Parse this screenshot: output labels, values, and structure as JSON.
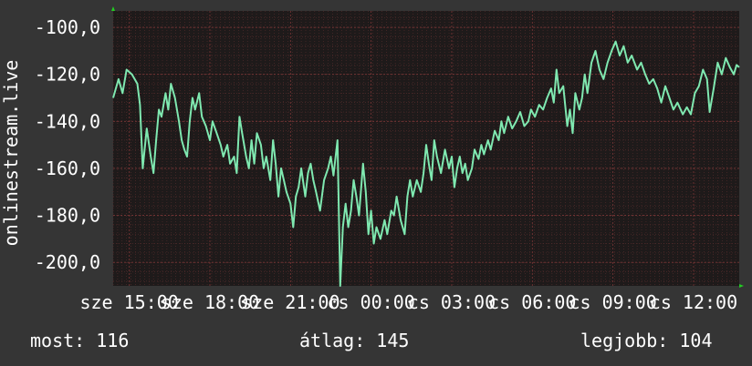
{
  "colors": {
    "background": "#353535",
    "plot_background": "#1e1a1a",
    "grid_minor": "#5a2e2e",
    "grid_major": "#7a3636",
    "line": "#7fe8b0",
    "axis_arrow": "#22cc22",
    "text": "#ffffff"
  },
  "stats": {
    "now_label": "most:",
    "now_value": "116",
    "avg_label": "átlag:",
    "avg_value": "145",
    "best_label": "legjobb:",
    "best_value": "104"
  },
  "chart_data": {
    "type": "line",
    "title": "",
    "ylabel": "onlinestream.live",
    "xlabel": "",
    "y_axis_inverted": true,
    "ylim": [
      -93,
      -210
    ],
    "y_ticks": [
      -100,
      -120,
      -140,
      -160,
      -180,
      -200
    ],
    "y_tick_labels": [
      "-100,0",
      "-120,0",
      "-140,0",
      "-160,0",
      "-180,0",
      "-200,0"
    ],
    "x_range_hours": [
      0,
      23.3
    ],
    "x_ticks": [
      {
        "day": "sze",
        "time": "15:00",
        "t": 0.6
      },
      {
        "day": "sze",
        "time": "18:00",
        "t": 3.6
      },
      {
        "day": "sze",
        "time": "21:00",
        "t": 6.6
      },
      {
        "day": "cs",
        "time": "00:00",
        "t": 9.6
      },
      {
        "day": "cs",
        "time": "03:00",
        "t": 12.6
      },
      {
        "day": "cs",
        "time": "06:00",
        "t": 15.6
      },
      {
        "day": "cs",
        "time": "09:00",
        "t": 18.6
      },
      {
        "day": "cs",
        "time": "12:00",
        "t": 21.6
      }
    ],
    "grid": true,
    "series": [
      {
        "values": [
          [
            0.0,
            -130
          ],
          [
            0.2,
            -122
          ],
          [
            0.35,
            -128
          ],
          [
            0.5,
            -118
          ],
          [
            0.7,
            -120
          ],
          [
            0.9,
            -124
          ],
          [
            1.0,
            -133
          ],
          [
            1.1,
            -160
          ],
          [
            1.25,
            -143
          ],
          [
            1.4,
            -155
          ],
          [
            1.5,
            -162
          ],
          [
            1.6,
            -148
          ],
          [
            1.7,
            -135
          ],
          [
            1.8,
            -138
          ],
          [
            1.95,
            -128
          ],
          [
            2.05,
            -135
          ],
          [
            2.15,
            -124
          ],
          [
            2.3,
            -130
          ],
          [
            2.45,
            -140
          ],
          [
            2.55,
            -148
          ],
          [
            2.65,
            -152
          ],
          [
            2.75,
            -155
          ],
          [
            2.85,
            -140
          ],
          [
            2.95,
            -130
          ],
          [
            3.05,
            -135
          ],
          [
            3.2,
            -128
          ],
          [
            3.3,
            -138
          ],
          [
            3.45,
            -142
          ],
          [
            3.6,
            -148
          ],
          [
            3.7,
            -140
          ],
          [
            3.85,
            -145
          ],
          [
            4.0,
            -150
          ],
          [
            4.1,
            -155
          ],
          [
            4.25,
            -150
          ],
          [
            4.35,
            -158
          ],
          [
            4.5,
            -155
          ],
          [
            4.6,
            -162
          ],
          [
            4.7,
            -138
          ],
          [
            4.8,
            -145
          ],
          [
            4.95,
            -155
          ],
          [
            5.05,
            -160
          ],
          [
            5.15,
            -148
          ],
          [
            5.25,
            -158
          ],
          [
            5.35,
            -145
          ],
          [
            5.5,
            -150
          ],
          [
            5.6,
            -160
          ],
          [
            5.7,
            -155
          ],
          [
            5.85,
            -165
          ],
          [
            5.95,
            -148
          ],
          [
            6.05,
            -158
          ],
          [
            6.15,
            -172
          ],
          [
            6.25,
            -160
          ],
          [
            6.35,
            -165
          ],
          [
            6.45,
            -170
          ],
          [
            6.6,
            -175
          ],
          [
            6.7,
            -185
          ],
          [
            6.8,
            -172
          ],
          [
            6.9,
            -168
          ],
          [
            7.0,
            -160
          ],
          [
            7.15,
            -172
          ],
          [
            7.25,
            -162
          ],
          [
            7.35,
            -158
          ],
          [
            7.45,
            -165
          ],
          [
            7.55,
            -170
          ],
          [
            7.7,
            -178
          ],
          [
            7.85,
            -165
          ],
          [
            8.0,
            -160
          ],
          [
            8.1,
            -155
          ],
          [
            8.2,
            -163
          ],
          [
            8.35,
            -148
          ],
          [
            8.45,
            -210
          ],
          [
            8.55,
            -185
          ],
          [
            8.65,
            -175
          ],
          [
            8.75,
            -185
          ],
          [
            8.85,
            -178
          ],
          [
            8.95,
            -165
          ],
          [
            9.05,
            -172
          ],
          [
            9.15,
            -180
          ],
          [
            9.3,
            -158
          ],
          [
            9.4,
            -170
          ],
          [
            9.5,
            -188
          ],
          [
            9.6,
            -178
          ],
          [
            9.7,
            -192
          ],
          [
            9.8,
            -185
          ],
          [
            9.95,
            -190
          ],
          [
            10.1,
            -182
          ],
          [
            10.2,
            -188
          ],
          [
            10.35,
            -178
          ],
          [
            10.45,
            -180
          ],
          [
            10.55,
            -172
          ],
          [
            10.7,
            -182
          ],
          [
            10.85,
            -188
          ],
          [
            10.95,
            -172
          ],
          [
            11.05,
            -165
          ],
          [
            11.15,
            -172
          ],
          [
            11.3,
            -165
          ],
          [
            11.45,
            -170
          ],
          [
            11.55,
            -162
          ],
          [
            11.65,
            -150
          ],
          [
            11.75,
            -158
          ],
          [
            11.85,
            -165
          ],
          [
            11.95,
            -148
          ],
          [
            12.05,
            -155
          ],
          [
            12.2,
            -162
          ],
          [
            12.35,
            -152
          ],
          [
            12.5,
            -160
          ],
          [
            12.6,
            -155
          ],
          [
            12.7,
            -168
          ],
          [
            12.8,
            -160
          ],
          [
            12.9,
            -155
          ],
          [
            13.0,
            -162
          ],
          [
            13.1,
            -158
          ],
          [
            13.2,
            -165
          ],
          [
            13.35,
            -160
          ],
          [
            13.45,
            -152
          ],
          [
            13.6,
            -156
          ],
          [
            13.7,
            -150
          ],
          [
            13.8,
            -154
          ],
          [
            13.95,
            -148
          ],
          [
            14.05,
            -152
          ],
          [
            14.2,
            -144
          ],
          [
            14.35,
            -148
          ],
          [
            14.45,
            -140
          ],
          [
            14.55,
            -145
          ],
          [
            14.7,
            -138
          ],
          [
            14.85,
            -143
          ],
          [
            15.0,
            -140
          ],
          [
            15.15,
            -136
          ],
          [
            15.3,
            -142
          ],
          [
            15.45,
            -140
          ],
          [
            15.55,
            -135
          ],
          [
            15.7,
            -138
          ],
          [
            15.85,
            -133
          ],
          [
            16.0,
            -135
          ],
          [
            16.15,
            -130
          ],
          [
            16.3,
            -126
          ],
          [
            16.4,
            -132
          ],
          [
            16.5,
            -118
          ],
          [
            16.6,
            -128
          ],
          [
            16.75,
            -125
          ],
          [
            16.9,
            -142
          ],
          [
            17.0,
            -135
          ],
          [
            17.1,
            -145
          ],
          [
            17.2,
            -128
          ],
          [
            17.35,
            -135
          ],
          [
            17.45,
            -130
          ],
          [
            17.55,
            -120
          ],
          [
            17.65,
            -128
          ],
          [
            17.8,
            -115
          ],
          [
            17.95,
            -110
          ],
          [
            18.1,
            -118
          ],
          [
            18.25,
            -122
          ],
          [
            18.4,
            -115
          ],
          [
            18.55,
            -110
          ],
          [
            18.7,
            -106
          ],
          [
            18.85,
            -112
          ],
          [
            19.0,
            -108
          ],
          [
            19.15,
            -115
          ],
          [
            19.3,
            -112
          ],
          [
            19.5,
            -118
          ],
          [
            19.65,
            -115
          ],
          [
            19.8,
            -120
          ],
          [
            19.95,
            -124
          ],
          [
            20.1,
            -122
          ],
          [
            20.25,
            -126
          ],
          [
            20.4,
            -132
          ],
          [
            20.55,
            -125
          ],
          [
            20.7,
            -130
          ],
          [
            20.85,
            -135
          ],
          [
            21.0,
            -132
          ],
          [
            21.2,
            -137
          ],
          [
            21.35,
            -134
          ],
          [
            21.5,
            -137
          ],
          [
            21.65,
            -128
          ],
          [
            21.8,
            -125
          ],
          [
            21.95,
            -118
          ],
          [
            22.1,
            -122
          ],
          [
            22.2,
            -136
          ],
          [
            22.35,
            -126
          ],
          [
            22.5,
            -115
          ],
          [
            22.65,
            -120
          ],
          [
            22.8,
            -113
          ],
          [
            22.95,
            -117
          ],
          [
            23.1,
            -120
          ],
          [
            23.2,
            -116
          ],
          [
            23.3,
            -117
          ]
        ]
      }
    ]
  }
}
